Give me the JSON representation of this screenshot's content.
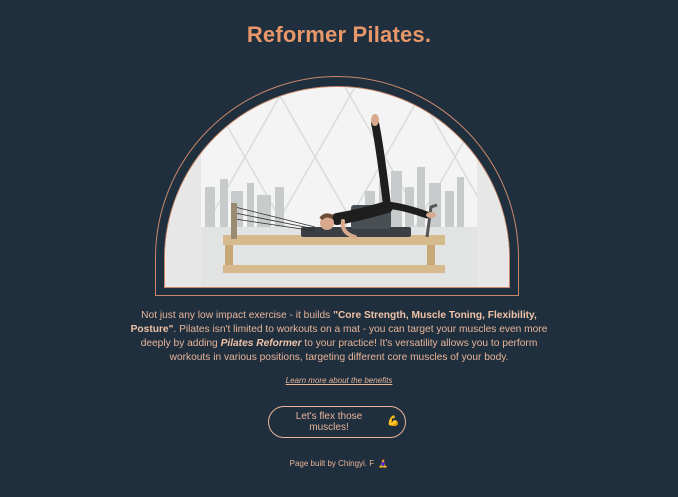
{
  "header": {
    "title": "Reformer Pilates."
  },
  "hero": {
    "image_alt": "Woman performing pilates on a reformer machine in a bright studio with a city skyline"
  },
  "description": {
    "part1": "Not just any low impact exercise - it builds ",
    "bold1": "\"Core Strength, Muscle Toning, Flexibility, Posture\"",
    "part2": ". Pilates isn't limited to workouts on a mat - you can target your muscles even more deeply by adding ",
    "bold2": "Pilates Reformer",
    "part3": " to your practice! It's versatility allows you to perform workouts in various positions, targeting different core muscles of your body."
  },
  "learn_link": {
    "label": "Learn more about the benefits"
  },
  "cta": {
    "label": "Let's flex those muscles!",
    "icon": "💪"
  },
  "footer": {
    "text": "Page built by Chingyi. F",
    "icon": "🧘‍♀️"
  },
  "colors": {
    "background": "#1f2f3d",
    "accent": "#e8976a",
    "text": "#e8b49a"
  }
}
